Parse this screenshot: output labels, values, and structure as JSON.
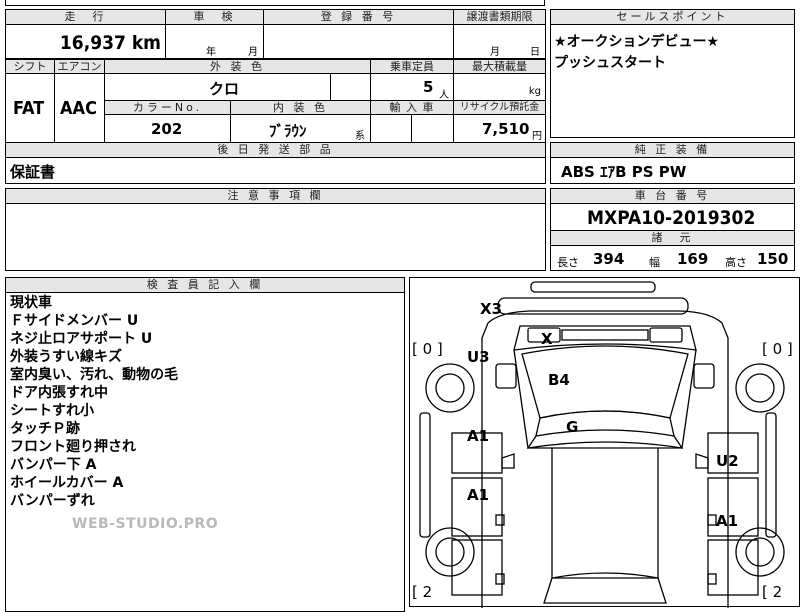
{
  "top": {
    "mileage_hdr": "走　行",
    "inspection_hdr": "車　検",
    "reg_hdr": "登 録 番 号",
    "transfer_hdr": "譲渡書類期限",
    "mileage": "16,937 km",
    "inspection_year": "年",
    "inspection_month": "月",
    "transfer_month": "月",
    "transfer_day": "日"
  },
  "sales_point": {
    "hdr": "セールスポイント",
    "lines": [
      "★オークションデビュー★",
      "プッシュスタート"
    ]
  },
  "row2": {
    "shift_hdr": "シフト",
    "ac_hdr": "エアコン",
    "ext_color_hdr": "外 装 色",
    "capacity_hdr": "乗車定員",
    "maxload_hdr": "最大積載量",
    "shift": "FAT",
    "ac": "AAC",
    "ext_color": "クロ",
    "capacity": "5",
    "capacity_unit": "人",
    "maxload_unit": "kg",
    "color_no_hdr": "カラーNo.",
    "int_color_hdr": "内 装 色",
    "import_hdr": "輸 入 車",
    "recycle_hdr": "リサイクル預託金",
    "color_no": "202",
    "int_color": "ﾌﾞﾗｳﾝ",
    "int_color_suffix": "系",
    "recycle": "7,510",
    "recycle_unit": "円"
  },
  "later_parts": {
    "hdr": "後 日 発 送 部 品",
    "value": "保証書"
  },
  "equipment": {
    "hdr": "純 正 装 備",
    "value": "ABS ｴｱB PS PW"
  },
  "notes": {
    "hdr": "注 意 事 項 欄"
  },
  "chassis": {
    "hdr": "車 台 番 号",
    "value": "MXPA10-2019302"
  },
  "specs": {
    "hdr": "諸　元",
    "length_lbl": "長さ",
    "length": "394",
    "width_lbl": "幅",
    "width": "169",
    "height_lbl": "高さ",
    "height": "150"
  },
  "inspector": {
    "hdr": "検 査 員 記 入 欄",
    "lines": [
      "現状車",
      "Ｆサイドメンバー U",
      "ネジ止ロアサポート U",
      "外装うすい線キズ",
      "室内臭い、汚れ、動物の毛",
      "ドア内張すれ中",
      "シートすれ小",
      "タッチＰ跡",
      "フロント廻り押され",
      "バンパー下 A",
      "ホイールカバー A",
      "バンパーずれ"
    ]
  },
  "watermark": "WEB-STUDIO.PRO",
  "diagram": {
    "tire_fl": "[ 0 ]",
    "tire_fr": "[ 0 ]",
    "tire_rl": "[ 2",
    "tire_rr": "[ 2",
    "marks": {
      "x3": "X3",
      "x": "X",
      "u3": "U3",
      "b4": "B4",
      "g": "G",
      "a1_l1": "A1",
      "a1_l2": "A1",
      "u2": "U2",
      "a1_r": "A1"
    }
  }
}
